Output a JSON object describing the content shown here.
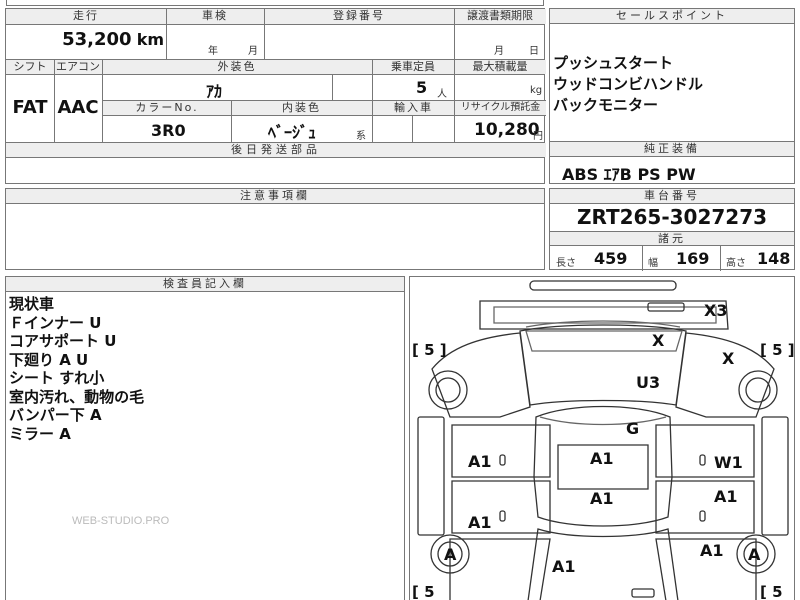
{
  "header": {
    "mileage_label": "走行",
    "inspection_label": "車検",
    "registration_label": "登録番号",
    "transfer_label": "譲渡書類期限",
    "sales_points_label": "セールスポイント"
  },
  "mileage": {
    "value": "53,200",
    "unit": "km"
  },
  "inspection": {
    "year_label": "年",
    "month_label": "月"
  },
  "transfer": {
    "month_label": "月",
    "day_label": "日"
  },
  "row2_headers": {
    "shift": "シフト",
    "aircon": "エアコン",
    "exterior": "外装色",
    "capacity": "乗車定員",
    "max_load": "最大積載量"
  },
  "shift": "FAT",
  "aircon": "AAC",
  "exterior_color": "ｱｶ",
  "capacity": {
    "value": "5",
    "unit": "人"
  },
  "max_load": {
    "unit": "kg"
  },
  "row3_headers": {
    "color_no": "カラーNo.",
    "interior": "内装色",
    "import": "輸入車",
    "recycle": "リサイクル預託金"
  },
  "color_no": "3R0",
  "interior": {
    "value": "ﾍﾞｰｼﾞｭ",
    "suffix": "系"
  },
  "recycle": {
    "value": "10,280",
    "unit": "円"
  },
  "later_parts_label": "後日発送部品",
  "sales_points": [
    "プッシュスタート",
    "ウッドコンビハンドル",
    "バックモニター"
  ],
  "standard_equipment": {
    "label": "純正装備",
    "value": "ABS ｴｱB PS PW"
  },
  "notes_label": "注意事項欄",
  "chassis": {
    "label": "車台番号",
    "value": "ZRT265-3027273"
  },
  "specs": {
    "label": "諸元",
    "length_label": "長さ",
    "length": "459",
    "width_label": "幅",
    "width": "169",
    "height_label": "高さ",
    "height": "148"
  },
  "inspector": {
    "label": "検査員記入欄",
    "lines": [
      "現状車",
      "Ｆインナー U",
      "コアサポート U",
      "下廻り A U",
      "シート すれ小",
      "室内汚れ、動物の毛",
      "バンパー下 A",
      "ミラー A"
    ],
    "watermark": "WEB-STUDIO.PRO"
  },
  "diagram": {
    "marks": [
      {
        "id": "roof-top",
        "text": "X3"
      },
      {
        "id": "windshield",
        "text": "X"
      },
      {
        "id": "fender-right",
        "text": "X"
      },
      {
        "id": "hood",
        "text": "U3"
      },
      {
        "id": "hood-rear",
        "text": "G"
      },
      {
        "id": "front-door-left",
        "text": "A1"
      },
      {
        "id": "roof-front",
        "text": "A1"
      },
      {
        "id": "front-door-right",
        "text": "W1"
      },
      {
        "id": "roof-rear",
        "text": "A1"
      },
      {
        "id": "rear-door-right",
        "text": "A1"
      },
      {
        "id": "rear-door-left",
        "text": "A1"
      },
      {
        "id": "quarter-right",
        "text": "A1"
      },
      {
        "id": "wheel-rear-left",
        "text": "A"
      },
      {
        "id": "wheel-rear-right",
        "text": "A"
      },
      {
        "id": "trunk",
        "text": "A1"
      }
    ],
    "tire_tags": [
      "[ 5 ]",
      "[ 5 ]",
      "[ 5",
      "[ 5"
    ]
  }
}
